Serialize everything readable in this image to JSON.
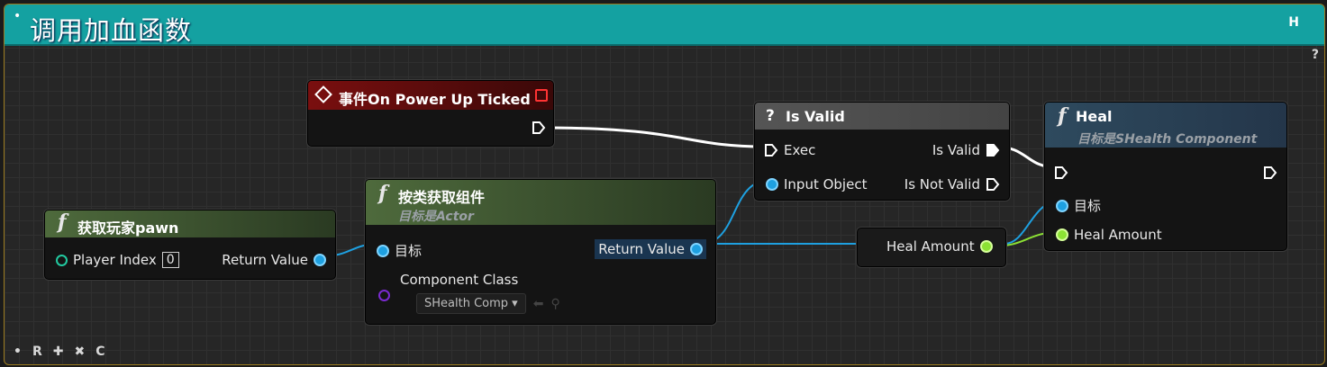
{
  "graph": {
    "title": "调用加血函数",
    "title_dot": "•",
    "hotkey": "H",
    "help": "?",
    "bottom": {
      "dot": "•",
      "r": "R",
      "plus": "✚",
      "x": "✖",
      "c": "C"
    }
  },
  "nodes": {
    "event": {
      "title": "事件On Power Up Ticked"
    },
    "get_pawn": {
      "title": "获取玩家pawn",
      "pin_player_index": "Player Index",
      "player_index_value": "0",
      "pin_return": "Return Value"
    },
    "get_component": {
      "title": "按类获取组件",
      "subtitle": "目标是Actor",
      "pin_target": "目标",
      "pin_return": "Return Value",
      "pin_component_class": "Component Class",
      "component_class_value": "SHealth Comp"
    },
    "is_valid": {
      "title": "Is Valid",
      "pin_exec": "Exec",
      "pin_input": "Input Object",
      "pin_valid": "Is Valid",
      "pin_not_valid": "Is Not Valid"
    },
    "heal_amount_var": {
      "label": "Heal Amount"
    },
    "heal": {
      "title": "Heal",
      "subtitle": "目标是SHealth Component",
      "pin_target": "目标",
      "pin_amount": "Heal Amount"
    }
  },
  "colors": {
    "title_bar": "#14a1a1",
    "object_pin": "#1ea0e0",
    "float_pin": "#8ce234",
    "exec": "#ffffff",
    "class_pin": "#7b2bd1",
    "selection": "#d18a12"
  }
}
